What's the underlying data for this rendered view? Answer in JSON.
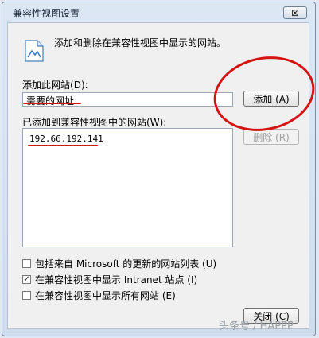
{
  "window": {
    "title": "兼容性视图设置",
    "close_glyph": "⊠"
  },
  "description": "添加和删除在兼容性视图中显示的网站。",
  "add_site": {
    "label": "添加此网站",
    "shortcut": "(D):",
    "value": "需要的网址",
    "add_button": "添加 (A)"
  },
  "added_sites": {
    "label": "已添加到兼容性视图中的网站",
    "shortcut": "(W):",
    "items": [
      "192.66.192.141"
    ],
    "remove_button": "删除 (R)"
  },
  "options": [
    {
      "label": "包括来自 Microsoft 的更新的网站列表 (U)",
      "checked": false
    },
    {
      "label": "在兼容性视图中显示 Intranet 站点 (I)",
      "checked": true
    },
    {
      "label": "在兼容性视图中显示所有网站 (E)",
      "checked": false
    }
  ],
  "close_button": "关闭 (C)",
  "watermark": "头条号 / HAPPP",
  "colors": {
    "annotation_red": "#d41414"
  }
}
